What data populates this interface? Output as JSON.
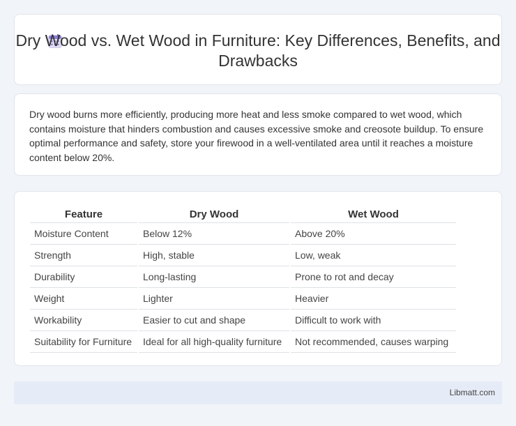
{
  "header": {
    "icon": "calendar-icon",
    "title": "Dry Wood vs. Wet Wood in Furniture: Key Differences, Benefits, and Drawbacks"
  },
  "summary": {
    "text": "Dry wood burns more efficiently, producing more heat and less smoke compared to wet wood, which contains moisture that hinders combustion and causes excessive smoke and creosote buildup. To ensure optimal performance and safety, store your firewood in a well-ventilated area until it reaches a moisture content below 20%."
  },
  "table": {
    "headers": [
      "Feature",
      "Dry Wood",
      "Wet Wood"
    ],
    "rows": [
      [
        "Moisture Content",
        "Below 12%",
        "Above 20%"
      ],
      [
        "Strength",
        "High, stable",
        "Low, weak"
      ],
      [
        "Durability",
        "Long-lasting",
        "Prone to rot and decay"
      ],
      [
        "Weight",
        "Lighter",
        "Heavier"
      ],
      [
        "Workability",
        "Easier to cut and shape",
        "Difficult to work with"
      ],
      [
        "Suitability for Furniture",
        "Ideal for all high-quality furniture",
        "Not recommended, causes warping"
      ]
    ]
  },
  "footer": {
    "site": "Libmatt.com"
  }
}
